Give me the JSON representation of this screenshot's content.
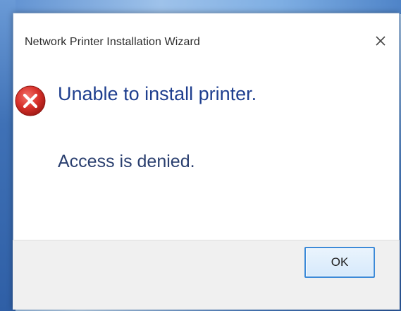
{
  "dialog": {
    "title": "Network Printer Installation Wizard",
    "main_instruction": "Unable to install printer.",
    "content": "Access is denied.",
    "ok_label": "OK",
    "icon": "error-icon",
    "close_icon": "close-icon"
  },
  "colors": {
    "instruction_text": "#1f3f8f",
    "error_icon": "#d7302a",
    "button_border": "#3c8ad8",
    "footer_background": "#f0f0f0"
  }
}
